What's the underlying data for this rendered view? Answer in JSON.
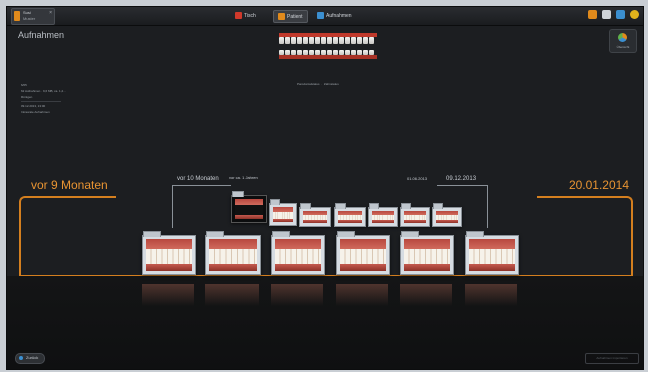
{
  "topbar": {
    "doc_tab": {
      "line1": "Susi",
      "line2": "Muster"
    },
    "nav": [
      {
        "label": "Tisch",
        "color": "#d0392b"
      },
      {
        "label": "Patient",
        "color": "#e08a1c"
      },
      {
        "label": "Aufnahmen",
        "color": "#3b8fd0"
      }
    ],
    "right_icons": [
      "#e08a1c",
      "#cfd3d8",
      "#3b8fd0",
      "#e0b21c"
    ]
  },
  "page": {
    "title": "Aufnahmen"
  },
  "info": {
    "line1": "6/05",
    "line2": "62 Aufnahmen · 9,6 MB, ca. 1,2...",
    "line3": "Röntgen",
    "line4": "09.12.2013, 13:00",
    "line5": "Intraorale Aufnahmen"
  },
  "chart_labels": {
    "left": "Parodontalstatus",
    "right": "Zahnstatus"
  },
  "export": {
    "label": "Übersicht"
  },
  "timeline": {
    "left_big": "vor 9 Monaten",
    "right_big": "20.01.2014",
    "mid_left": "vor 10 Monaten",
    "mid_left_small": "vor ca. 1 Jahren",
    "mid_right_small": "01.06.2013",
    "mid_right": "09.12.2013"
  },
  "footer": {
    "back_label": "Zurück",
    "right_label": "Aufnahmen importieren"
  },
  "colors": {
    "accent": "#e89432",
    "bracket": "#d47f1f",
    "background": "#1c1e21"
  }
}
